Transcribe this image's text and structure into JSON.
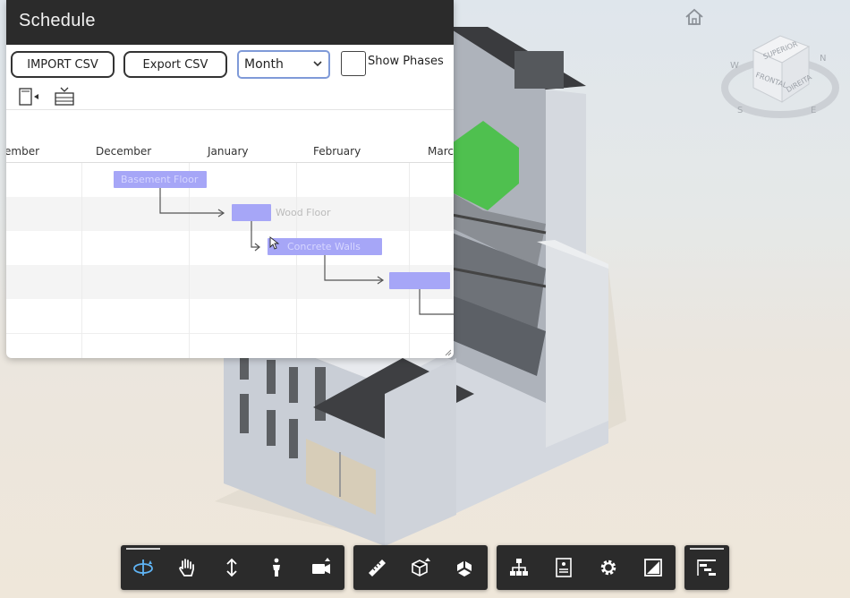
{
  "schedule": {
    "title": "Schedule",
    "import_label": "IMPORT CSV",
    "export_label": "Export CSV",
    "view_mode": "Month",
    "show_phases_label": "Show Phases",
    "show_phases_checked": false
  },
  "timeline": {
    "months": [
      "ember",
      "December",
      "January",
      "February",
      "March"
    ]
  },
  "tasks": [
    {
      "name": "Basement Floor"
    },
    {
      "name": "Wood Floor"
    },
    {
      "name": "Concrete Walls"
    },
    {
      "name": ""
    }
  ],
  "viewcube": {
    "top_label": "SUPERIOR",
    "front_label": "FRONTAL",
    "right_label": "DIREITA",
    "compass": [
      "N",
      "S",
      "E",
      "W"
    ]
  },
  "toolbar": {
    "groups": [
      [
        {
          "icon": "orbit-icon",
          "active": true
        },
        {
          "icon": "pan-hand-icon"
        },
        {
          "icon": "zoom-vertical-icon"
        },
        {
          "icon": "first-person-icon"
        },
        {
          "icon": "camera-icon"
        }
      ],
      [
        {
          "icon": "measure-ruler-icon"
        },
        {
          "icon": "section-box-icon"
        },
        {
          "icon": "explode-cube-icon"
        }
      ],
      [
        {
          "icon": "model-browser-icon"
        },
        {
          "icon": "properties-icon"
        },
        {
          "icon": "settings-gear-icon"
        },
        {
          "icon": "fullscreen-icon"
        }
      ],
      [
        {
          "icon": "schedule-gantt-icon",
          "active": true
        }
      ]
    ]
  },
  "colors": {
    "task_bar": "#a6a6f7",
    "toolbar_bg": "#2b2b2b",
    "accent_blue": "#5fb4f5",
    "select_border": "#7f9ad8"
  }
}
